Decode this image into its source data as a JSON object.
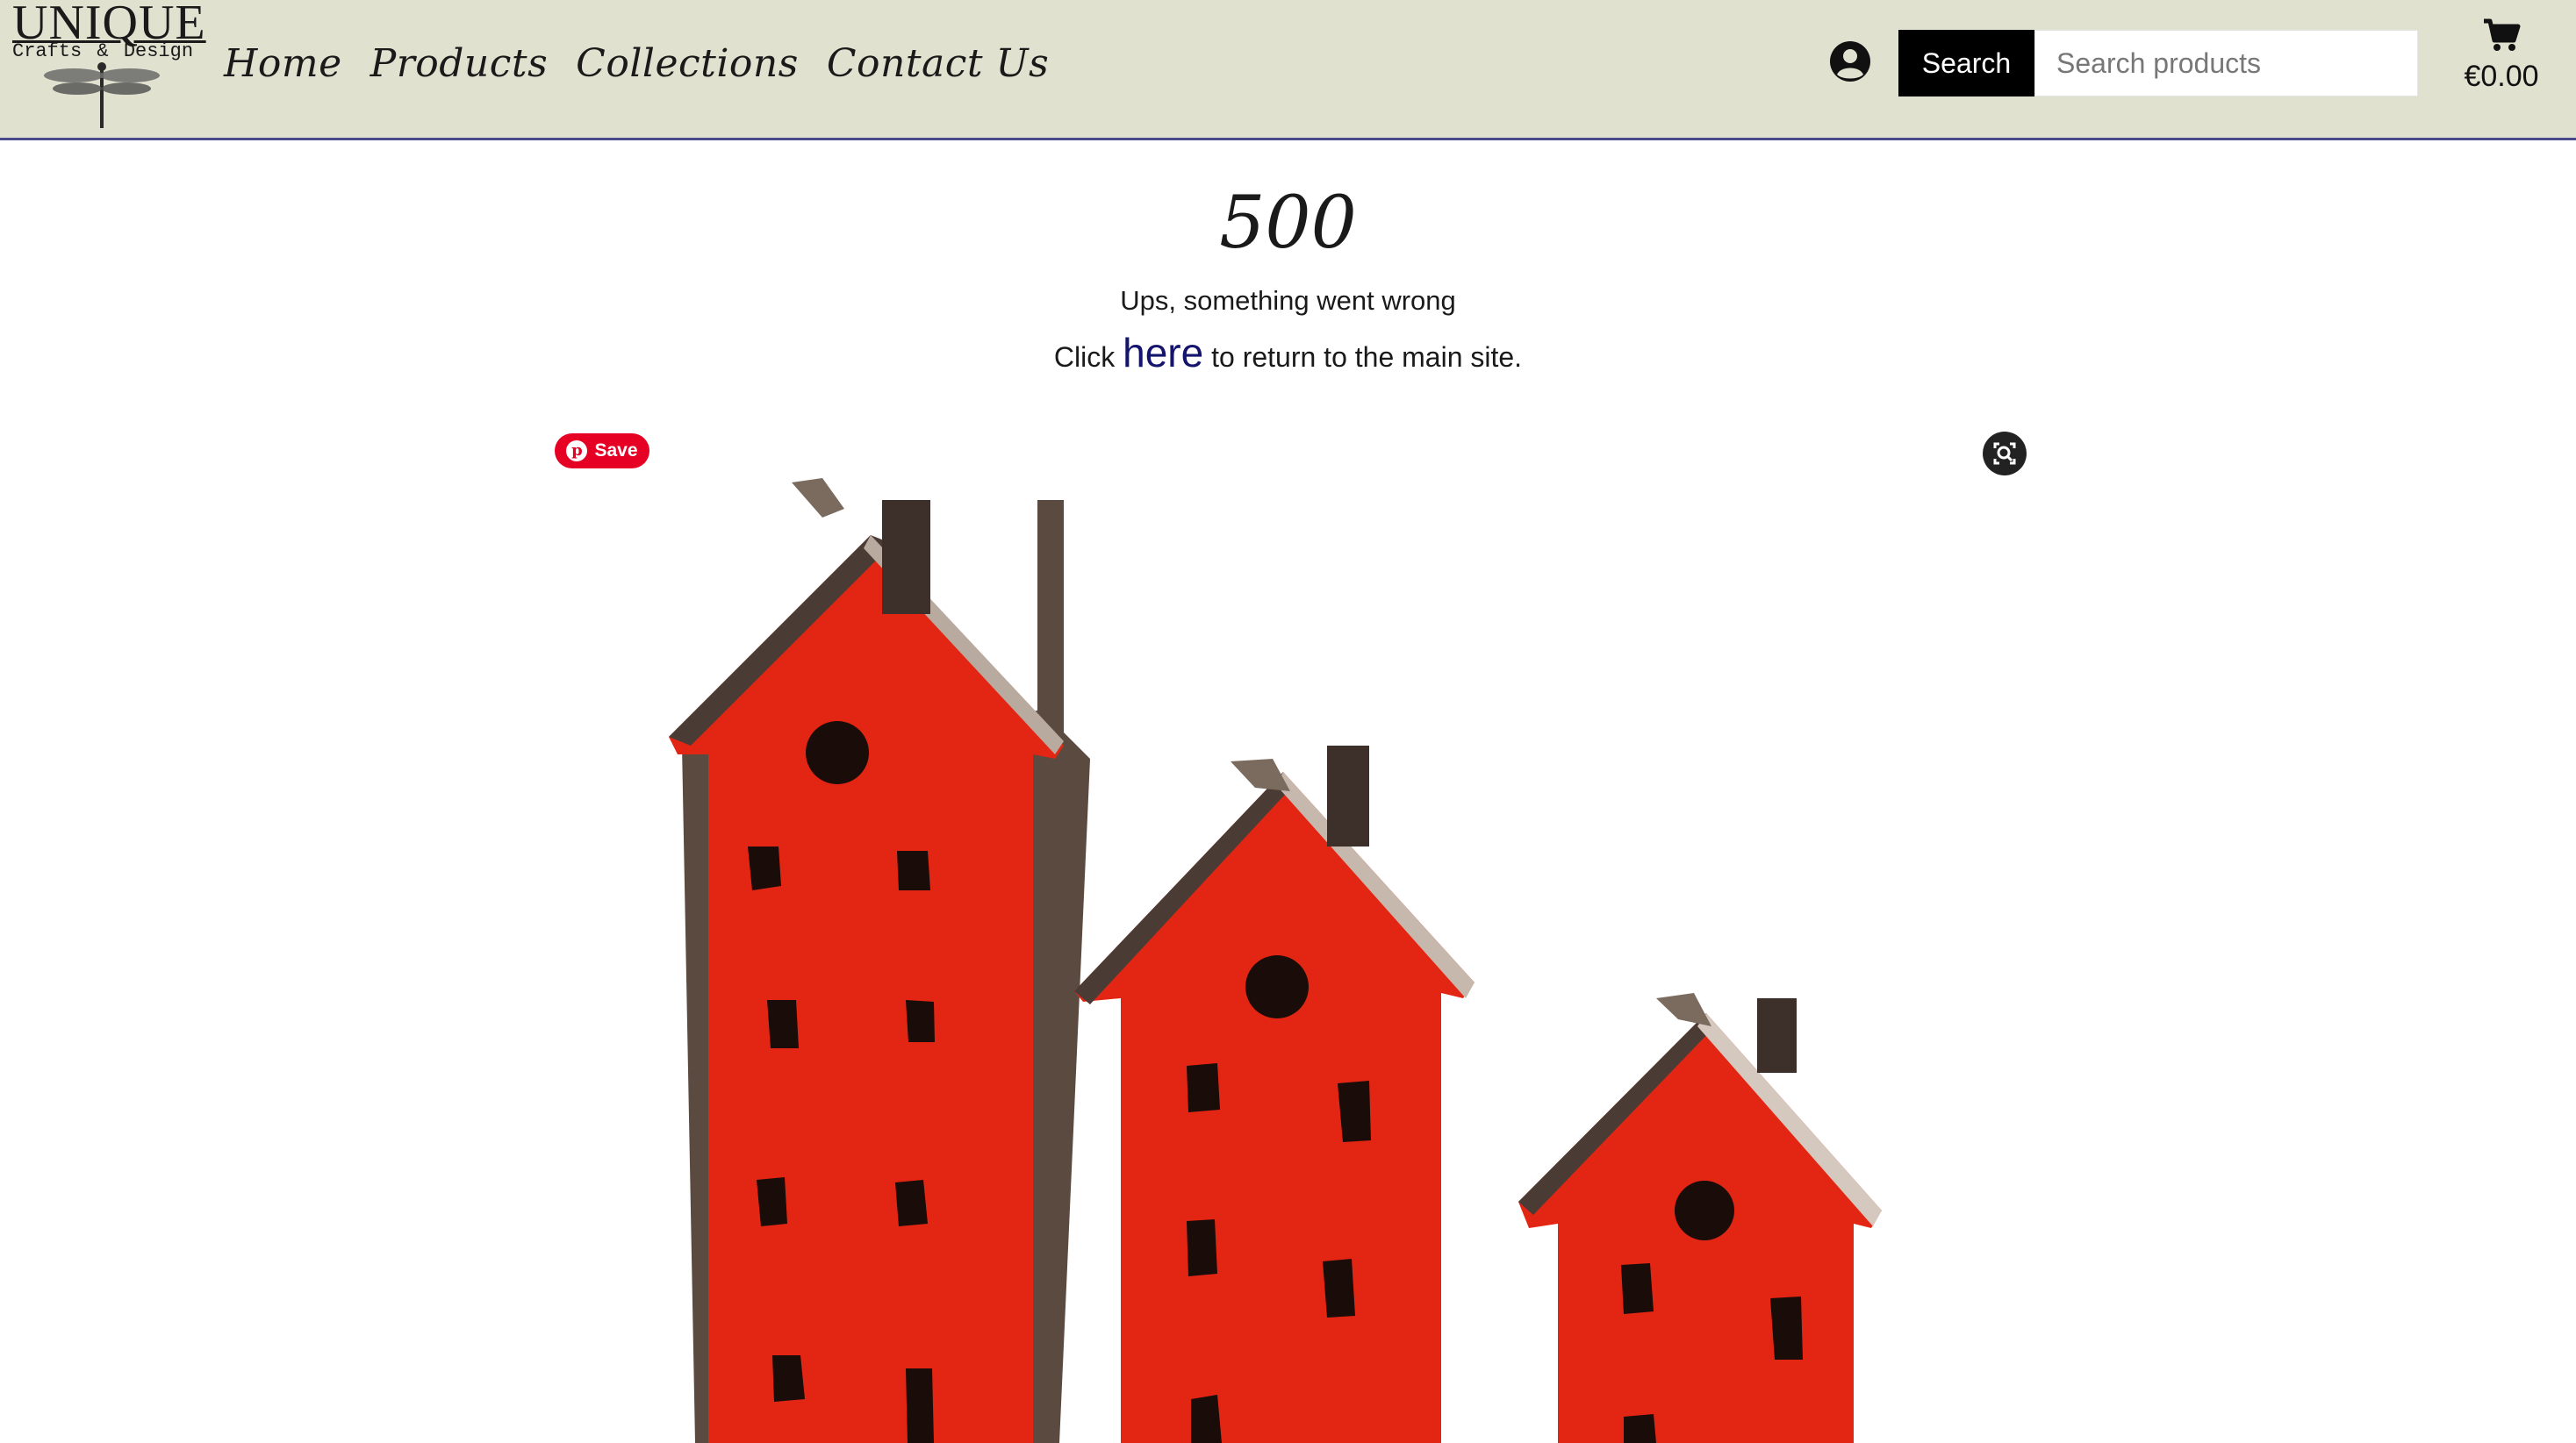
{
  "brand": {
    "logo_word": "UNIQUE",
    "logo_sub": "Crafts & Design"
  },
  "nav": {
    "items": [
      {
        "label": "Home"
      },
      {
        "label": "Products"
      },
      {
        "label": "Collections"
      },
      {
        "label": "Contact Us"
      }
    ]
  },
  "header": {
    "account_icon": "account-icon",
    "search_label": "Search",
    "search_placeholder": "Search products",
    "cart_icon": "cart-icon",
    "cart_total": "€0.00"
  },
  "error": {
    "code": "500",
    "message": "Ups, something went wrong",
    "link_prefix": "Click",
    "link_text": "here",
    "link_suffix": "to return to the main site."
  },
  "hero": {
    "pinterest_save_label": "Save",
    "lens_icon": "visual-search-icon",
    "colors": {
      "house_red": "#e32613",
      "roof_metal": "#5a4a40",
      "background": "#ffffff"
    }
  },
  "colors": {
    "header_bg": "#e1e1d0",
    "header_border": "#4a4a8a",
    "link": "#14146e",
    "pinterest": "#e60023"
  }
}
